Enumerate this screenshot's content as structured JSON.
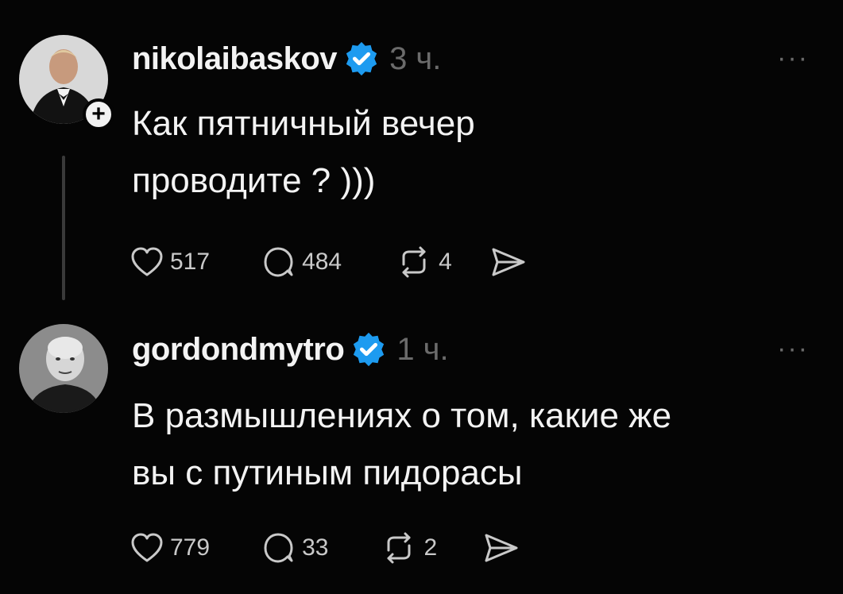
{
  "posts": [
    {
      "username": "nikolaibaskov",
      "time": "3 ч.",
      "text_line1": "Как пятничный вечер",
      "text_line2": "проводите ? )))",
      "likes": "517",
      "comments": "484",
      "reposts": "4",
      "more": "···",
      "follow_symbol": "+"
    },
    {
      "username": "gordondmytro",
      "time": "1 ч.",
      "text_line1": "В размышлениях о том, какие же",
      "text_line2": "вы с путиным пидорасы",
      "likes": "779",
      "comments": "33",
      "reposts": "2",
      "more": "···"
    }
  ],
  "icons": {
    "verified": "verified-badge-icon",
    "like": "heart-icon",
    "comment": "comment-bubble-icon",
    "repost": "repost-icon",
    "share": "send-icon",
    "more": "more-dots-icon"
  },
  "colors": {
    "background": "#050505",
    "text": "#f3f3f3",
    "muted": "#6b6b6b",
    "verified": "#1d9bf0"
  }
}
